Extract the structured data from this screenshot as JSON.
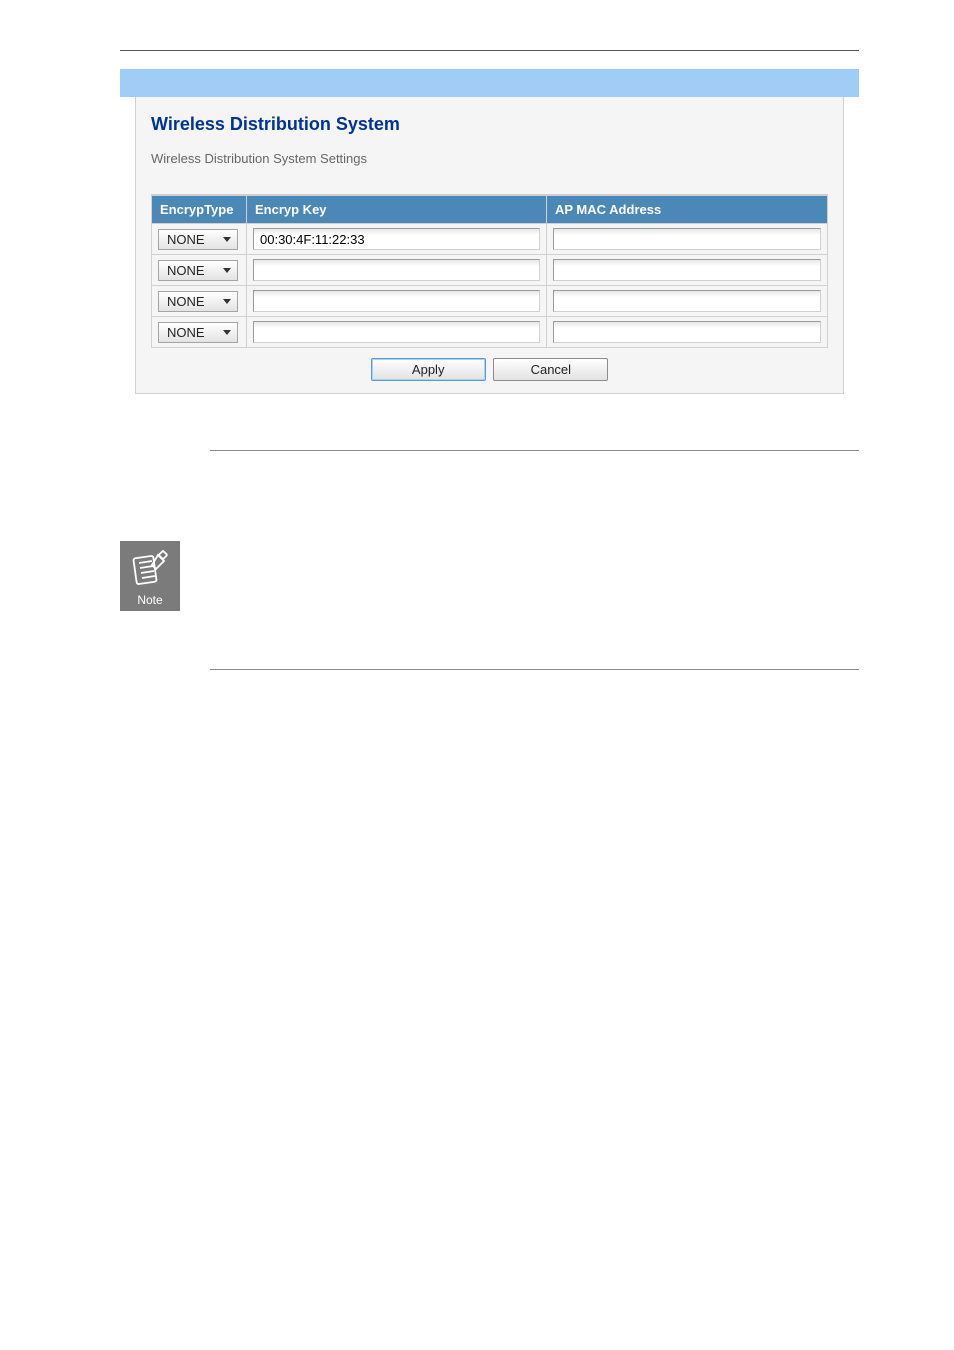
{
  "panel": {
    "title": "Wireless Distribution System",
    "subtitle": "Wireless Distribution System Settings"
  },
  "table": {
    "headers": {
      "encryp_type": "EncrypType",
      "encryp_key": "Encryp Key",
      "ap_mac": "AP MAC Address"
    },
    "rows": [
      {
        "encryp_type": "NONE",
        "encryp_key": "00:30:4F:11:22:33",
        "ap_mac": ""
      },
      {
        "encryp_type": "NONE",
        "encryp_key": "",
        "ap_mac": ""
      },
      {
        "encryp_type": "NONE",
        "encryp_key": "",
        "ap_mac": ""
      },
      {
        "encryp_type": "NONE",
        "encryp_key": "",
        "ap_mac": ""
      }
    ]
  },
  "buttons": {
    "apply": "Apply",
    "cancel": "Cancel"
  },
  "note": {
    "label": "Note"
  }
}
